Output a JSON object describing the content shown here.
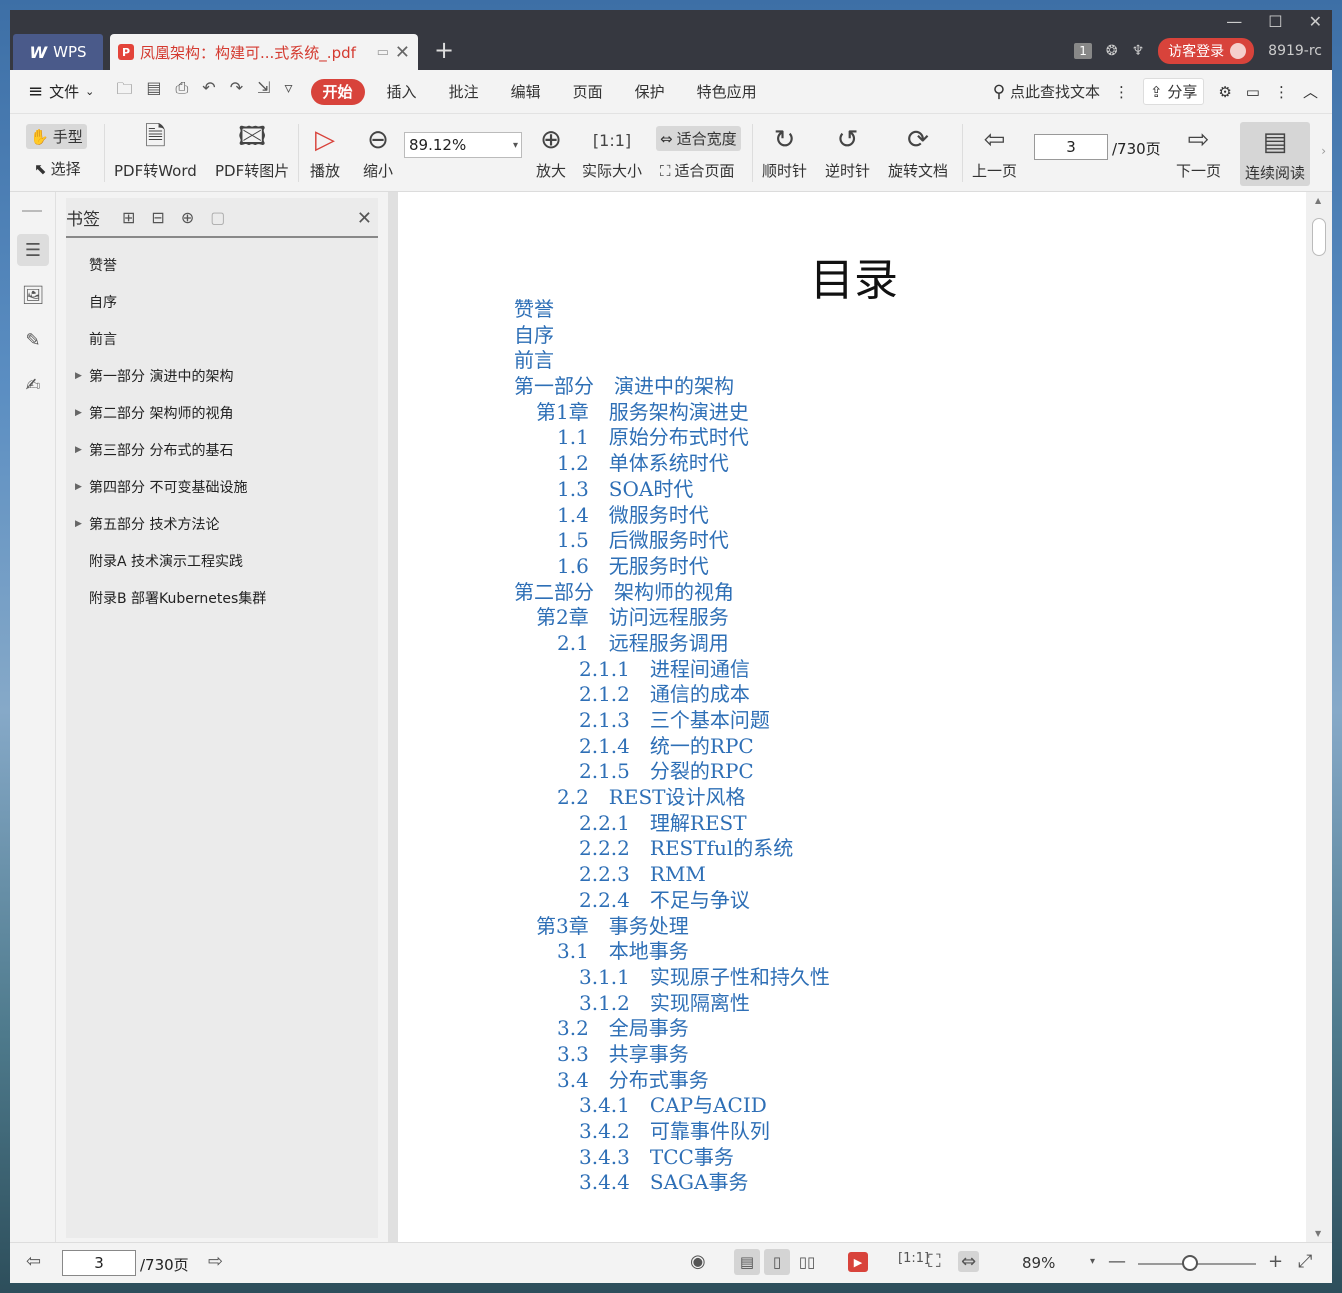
{
  "titlebar": {
    "app_tab": "WPS",
    "doc_tab": "凤凰架构：构建可...式系统_.pdf",
    "counter": "1",
    "login": "访客登录",
    "user_id": "8919-rc"
  },
  "menubar": {
    "file": "文件",
    "tabs": [
      "开始",
      "插入",
      "批注",
      "编辑",
      "页面",
      "保护",
      "特色应用"
    ],
    "search": "点此查找文本",
    "share": "分享"
  },
  "toolbar": {
    "hand": "手型",
    "select": "选择",
    "pdf_to_word": "PDF转Word",
    "pdf_to_image": "PDF转图片",
    "play": "播放",
    "zoom_out": "缩小",
    "zoom_value": "89.12%",
    "zoom_in": "放大",
    "actual_size": "实际大小",
    "fit_width": "适合宽度",
    "fit_page": "适合页面",
    "clockwise": "顺时针",
    "counterclockwise": "逆时针",
    "rotate_doc": "旋转文档",
    "prev_page": "上一页",
    "page_value": "3",
    "page_total": "/730页",
    "next_page": "下一页",
    "continuous": "连续阅读"
  },
  "bookmarks": {
    "title": "书签",
    "items": [
      {
        "label": "赞誉",
        "expandable": false
      },
      {
        "label": "自序",
        "expandable": false
      },
      {
        "label": "前言",
        "expandable": false
      },
      {
        "label": "第一部分 演进中的架构",
        "expandable": true
      },
      {
        "label": "第二部分 架构师的视角",
        "expandable": true
      },
      {
        "label": "第三部分 分布式的基石",
        "expandable": true
      },
      {
        "label": "第四部分 不可变基础设施",
        "expandable": true
      },
      {
        "label": "第五部分 技术方法论",
        "expandable": true
      },
      {
        "label": "附录A 技术演示工程实践",
        "expandable": false
      },
      {
        "label": "附录B 部署Kubernetes集群",
        "expandable": false
      }
    ]
  },
  "document": {
    "title": "目录",
    "toc": [
      {
        "level": 0,
        "text": "赞誉"
      },
      {
        "level": 0,
        "text": "自序"
      },
      {
        "level": 0,
        "text": "前言"
      },
      {
        "level": 0,
        "text": "第一部分　演进中的架构"
      },
      {
        "level": 1,
        "text": "第1章　服务架构演进史"
      },
      {
        "level": 2,
        "text": "1.1　原始分布式时代"
      },
      {
        "level": 2,
        "text": "1.2　单体系统时代"
      },
      {
        "level": 2,
        "text": "1.3　SOA时代"
      },
      {
        "level": 2,
        "text": "1.4　微服务时代"
      },
      {
        "level": 2,
        "text": "1.5　后微服务时代"
      },
      {
        "level": 2,
        "text": "1.6　无服务时代"
      },
      {
        "level": 0,
        "text": "第二部分　架构师的视角"
      },
      {
        "level": 1,
        "text": "第2章　访问远程服务"
      },
      {
        "level": 2,
        "text": "2.1　远程服务调用"
      },
      {
        "level": 3,
        "text": "2.1.1　进程间通信"
      },
      {
        "level": 3,
        "text": "2.1.2　通信的成本"
      },
      {
        "level": 3,
        "text": "2.1.3　三个基本问题"
      },
      {
        "level": 3,
        "text": "2.1.4　统一的RPC"
      },
      {
        "level": 3,
        "text": "2.1.5　分裂的RPC"
      },
      {
        "level": 2,
        "text": "2.2　REST设计风格"
      },
      {
        "level": 3,
        "text": "2.2.1　理解REST"
      },
      {
        "level": 3,
        "text": "2.2.2　RESTful的系统"
      },
      {
        "level": 3,
        "text": "2.2.3　RMM"
      },
      {
        "level": 3,
        "text": "2.2.4　不足与争议"
      },
      {
        "level": 1,
        "text": "第3章　事务处理"
      },
      {
        "level": 2,
        "text": "3.1　本地事务"
      },
      {
        "level": 3,
        "text": "3.1.1　实现原子性和持久性"
      },
      {
        "level": 3,
        "text": "3.1.2　实现隔离性"
      },
      {
        "level": 2,
        "text": "3.2　全局事务"
      },
      {
        "level": 2,
        "text": "3.3　共享事务"
      },
      {
        "level": 2,
        "text": "3.4　分布式事务"
      },
      {
        "level": 3,
        "text": "3.4.1　CAP与ACID"
      },
      {
        "level": 3,
        "text": "3.4.2　可靠事件队列"
      },
      {
        "level": 3,
        "text": "3.4.3　TCC事务"
      },
      {
        "level": 3,
        "text": "3.4.4　SAGA事务"
      }
    ]
  },
  "statusbar": {
    "page_value": "3",
    "page_total": "/730页",
    "zoom": "89%"
  },
  "colors": {
    "accent": "#d8433b",
    "toc_link": "#2e6fb6",
    "titlebar": "#363840"
  }
}
